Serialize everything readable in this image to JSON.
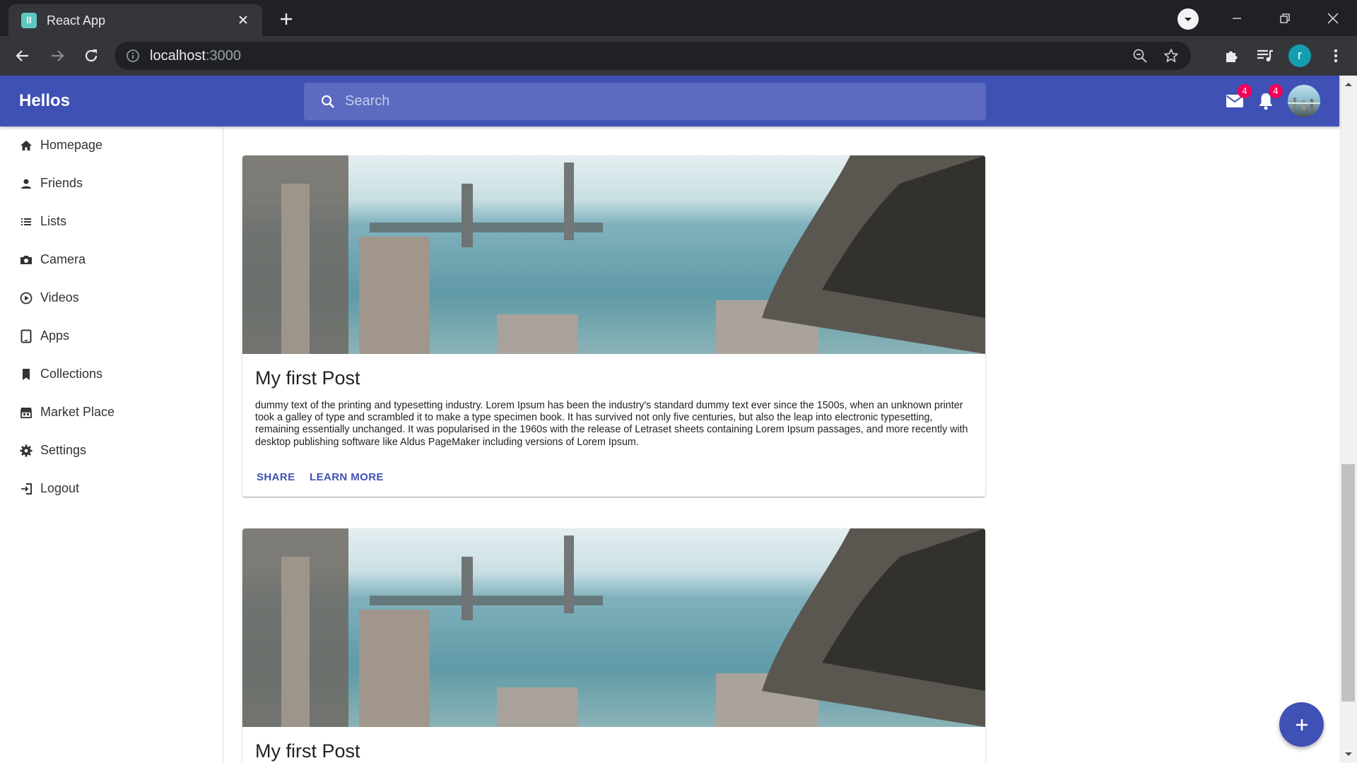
{
  "browser": {
    "tab_title": "React App",
    "favicon_glyph": "ll",
    "url_host": "localhost",
    "url_port": ":3000",
    "profile_initial": "r"
  },
  "appbar": {
    "brand": "Hellos",
    "search_placeholder": "Search",
    "mail_badge": "4",
    "notification_badge": "4",
    "color": "#3f51b5"
  },
  "sidebar": {
    "items": [
      {
        "label": "Homepage",
        "icon": "home-icon"
      },
      {
        "label": "Friends",
        "icon": "person-icon"
      },
      {
        "label": "Lists",
        "icon": "list-icon"
      },
      {
        "label": "Camera",
        "icon": "camera-icon"
      },
      {
        "label": "Videos",
        "icon": "play-circle-icon"
      },
      {
        "label": "Apps",
        "icon": "tablet-icon"
      },
      {
        "label": "Collections",
        "icon": "bookmark-icon"
      },
      {
        "label": "Market Place",
        "icon": "storefront-icon"
      },
      {
        "label": "Settings",
        "icon": "gear-icon"
      },
      {
        "label": "Logout",
        "icon": "exit-icon"
      }
    ]
  },
  "posts": [
    {
      "title": "My first Post",
      "body": "dummy text of the printing and typesetting industry. Lorem Ipsum has been the industry's standard dummy text ever since the 1500s, when an unknown printer took a galley of type and scrambled it to make a type specimen book. It has survived not only five centuries, but also the leap into electronic typesetting, remaining essentially unchanged. It was popularised in the 1960s with the release of Letraset sheets containing Lorem Ipsum passages, and more recently with desktop publishing software like Aldus PageMaker including versions of Lorem Ipsum.",
      "share_label": "SHARE",
      "learn_more_label": "LEARN MORE"
    },
    {
      "title": "My first Post"
    }
  ]
}
